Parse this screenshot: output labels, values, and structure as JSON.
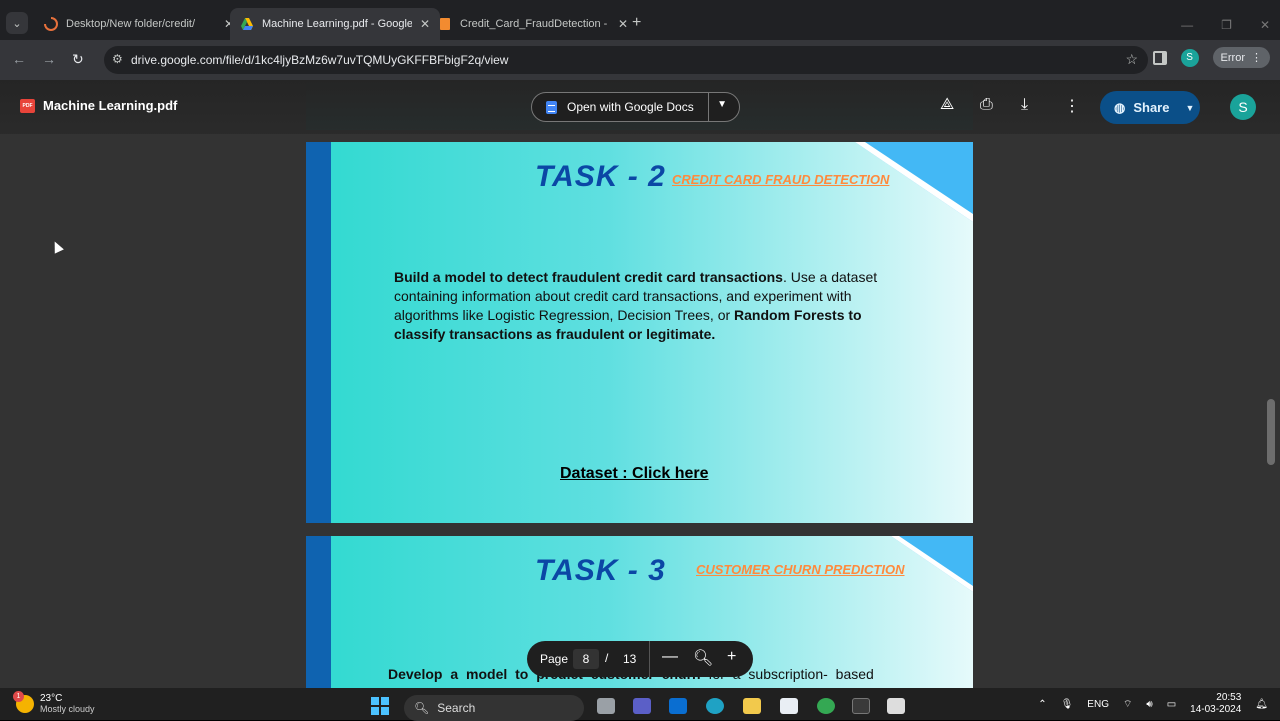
{
  "browser": {
    "tabs": [
      {
        "title": "Desktop/New folder/credit/",
        "active": false
      },
      {
        "title": "Machine Learning.pdf - Google",
        "active": true
      },
      {
        "title": "Credit_Card_FraudDetection - J",
        "active": false
      }
    ],
    "url": "drive.google.com/file/d/1kc4ljyBzMz6w7uvTQMUyGKFFBFbigF2q/view",
    "profile_initial": "S",
    "error_label": "Error"
  },
  "viewer": {
    "file_title": "Machine Learning.pdf",
    "open_with_label": "Open with Google Docs",
    "share_label": "Share",
    "avatar_initial": "S",
    "pdf_badge": "PDF"
  },
  "pages": [
    {
      "task": "TASK - 2",
      "subtitle": "CREDIT CARD FRAUD DETECTION",
      "body_bold_1": "Build a model to detect fraudulent credit card transactions",
      "body_normal": ". Use a dataset containing information about credit card transactions, and experiment with algorithms like Logistic Regression, Decision Trees, or ",
      "body_bold_2": "Random Forests to classify transactions as fraudulent or legitimate.",
      "dataset_link": "Dataset : Click here"
    },
    {
      "task": "TASK - 3",
      "subtitle": "CUSTOMER CHURN PREDICTION",
      "body_bold_1": "Develop a model to predict customer churn",
      "body_normal": " for a subscription- based"
    }
  ],
  "pager": {
    "label": "Page",
    "current": "8",
    "separator": "/",
    "total": "13"
  },
  "taskbar": {
    "weather_temp": "23°C",
    "weather_cond": "Mostly cloudy",
    "weather_badge": "1",
    "search_label": "Search",
    "language": "ENG",
    "time": "20:53",
    "date": "14-03-2024"
  },
  "colors": {
    "task_heading": "#0b47a5",
    "task_subtitle": "#ff8a3d",
    "page_stripe": "#0f63b0",
    "share_button": "#0b4f88"
  }
}
